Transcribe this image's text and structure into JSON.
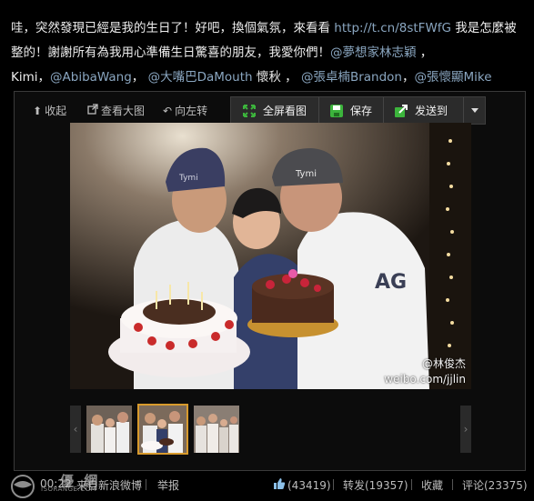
{
  "post": {
    "line1_a": "哇，突然發現已經是我的生日了！好吧，換個氣氛，來看看 ",
    "link": "http://t.cn/8stFWfG",
    "line1_b": " 我是怎麼被整的！謝謝所有為我用心準備生日驚喜的朋友，我愛你們！",
    "mention1": "@夢想家林志穎",
    "sep1": " ，",
    "line3_a": "Kimi，",
    "mention2": "@AbibaWang",
    "sep2": "， ",
    "mention3": "@大嘴巴DaMouth",
    "line3_b": " 懷秋 ， ",
    "mention4": "@張卓楠Brandon",
    "sep3": "，",
    "mention5": "@張懷顯Mike"
  },
  "toolbar": {
    "collapse": "收起",
    "view_large": "查看大图",
    "rotate_left": "向左转",
    "fullscreen": "全屏看图",
    "save": "保存",
    "send_to": "发送到"
  },
  "photo": {
    "watermark_name": "@林俊杰",
    "watermark_url": "weibo.com/jjlin",
    "cap_text_1": "Tymi",
    "cap_text_2": "Tymi",
    "shirt_text": "AG"
  },
  "footer": {
    "time": "00:22",
    "source": "来自新浪微博",
    "report": "举报",
    "likes": "(43419)",
    "repost": "转发(19357)",
    "favorite": "收藏",
    "comment": "评论(23375)",
    "site_watermark_top": "優 網",
    "site_watermark_bottom": "ISORANGE.COM"
  },
  "colors": {
    "background": "#000000",
    "link": "#8aa6c0",
    "selected_thumb_border": "#d89a2c",
    "save_icon": "#3cb43c"
  }
}
